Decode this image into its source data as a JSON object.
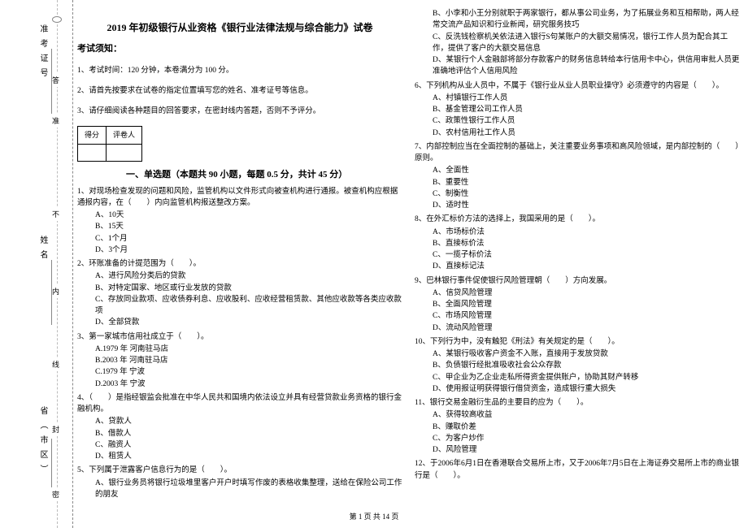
{
  "sidebar": {
    "answer": "答",
    "exam_id": "准考证号",
    "name": "姓名",
    "province": "省（市区）",
    "dash_ans": "答",
    "dash_zhun": "准",
    "dash_bu": "不",
    "dash_nei": "内",
    "dash_xian": "线",
    "dash_feng": "封",
    "dash_mi": "密"
  },
  "title": "2019 年初级银行从业资格《银行业法律法规与综合能力》试卷",
  "notice_title": "考试须知：",
  "notices": {
    "n1": "1、考试时间：120 分钟，本卷满分为 100 分。",
    "n2": "2、请首先按要求在试卷的指定位置填写您的姓名、准考证号等信息。",
    "n3": "3、请仔细阅读各种题目的回答要求，在密封线内答题，否则不予评分。"
  },
  "score": {
    "h1": "得分",
    "h2": "评卷人"
  },
  "section1_title": "一、单选题（本题共 90 小题，每题 0.5 分，共计 45 分）",
  "q1": {
    "stem": "1、对现场检查发现的问题和风险，监管机构以文件形式向被查机构进行通报。被查机构应根据通报内容，在（　　）内向监管机构报送整改方案。",
    "a": "A、10天",
    "b": "B、15天",
    "c": "C、1个月",
    "d": "D、3个月"
  },
  "q2": {
    "stem": "2、环账准备的计提范围为（　　）。",
    "a": "A、进行风险分类后的贷款",
    "b": "B、对特定国家、地区或行业发放的贷款",
    "c": "C、存放同业款项、应收债券利息、应收股利、应收经营租赁款、其他应收款等各类应收款项",
    "d": "D、全部贷款"
  },
  "q3": {
    "stem": "3、第一家城市信用社成立于（　　）。",
    "a": "A.1979 年 河南驻马店",
    "b": "B.2003 年 河南驻马店",
    "c": "C.1979 年 宁波",
    "d": "D.2003 年 宁波"
  },
  "q4": {
    "stem": "4、（　　）是指经银监会批准在中华人民共和国境内依法设立并具有经营贷款业务资格的银行金融机构。",
    "a": "A、贷款人",
    "b": "B、借款人",
    "c": "C、融资人",
    "d": "D、租赁人"
  },
  "q5": {
    "stem": "5、下列属于泄露客户信息行为的是（　　）。",
    "a": "A、银行业务员将银行垃圾堆里客户开户时填写作废的表格收集整理，送给在保险公司工作的朋友",
    "b": "B、小李和小王分别就职于两家银行，都从事公司业务，为了拓展业务和互相帮助，两人经常交流产品知识和行业新闻，研究服务技巧",
    "c": "C、反洗钱检察机关依法进入银行S句某账户的大额交易情况，银行工作人员为配合其工作，提供了客户的大额交易信息",
    "d": "D、某银行个人金融部将部分存款客户的财务信息转给本行信用卡中心，供信用审批人员更准确地评估个人信用风险"
  },
  "q6": {
    "stem": "6、下列机构从业人员中，不属于《银行业从业人员职业操守》必须遵守的内容是（　　）。",
    "a": "A、村镇银行工作人员",
    "b": "B、基金管理公司工作人员",
    "c": "C、政策性银行工作人员",
    "d": "D、农村信用社工作人员"
  },
  "q7": {
    "stem": "7、内部控制应当在全面控制的基础上，关注重要业务事项和高风险领域，是内部控制的（　　）原则。",
    "a": "A、全面性",
    "b": "B、重要性",
    "c": "C、制衡性",
    "d": "D、适时性"
  },
  "q8": {
    "stem": "8、在外汇标价方法的选择上，我国采用的是（　　）。",
    "a": "A、市场标价法",
    "b": "B、直接标价法",
    "c": "C、一揽子标价法",
    "d": "D、直接标记法"
  },
  "q9": {
    "stem": "9、巴林银行事件促使银行风险管理朝（　　）方向发展。",
    "a": "A、信贷风险管理",
    "b": "B、全面风险管理",
    "c": "C、市场风险管理",
    "d": "D、流动风险管理"
  },
  "q10": {
    "stem": "10、下列行为中，没有触犯《刑法》有关规定的是（　　）。",
    "a": "A、某银行吸收客户资金不入账，直接用于发放贷款",
    "b": "B、负债银行经批准吸收社会公众存款",
    "c": "C、甲企业为乙企业走私所得资金提供账户，协助其财产转移",
    "d": "D、使用报证明获得银行借贷资金，造成银行重大损失"
  },
  "q11": {
    "stem": "11、银行交易金融衍生品的主要目的应为（　　）。",
    "a": "A、获得较高收益",
    "b": "B、赚取价差",
    "c": "C、为客户炒作",
    "d": "D、风险管理"
  },
  "q12": {
    "stem": "12、于2006年6月1日在香港联合交易所上市，又于2006年7月5日在上海证券交易所上市的商业银行是（　　）。"
  },
  "footer": "第 1 页 共 14 页"
}
